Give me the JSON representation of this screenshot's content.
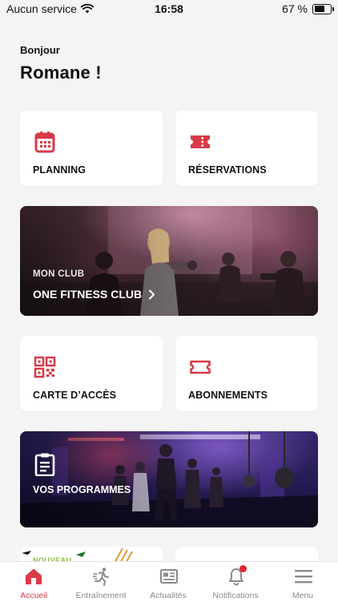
{
  "status_bar": {
    "carrier": "Aucun service",
    "time": "16:58",
    "battery_text": "67 %",
    "battery_level": 0.67
  },
  "header": {
    "greeting": "Bonjour",
    "user_name": "Romane !"
  },
  "tiles": {
    "planning": "PLANNING",
    "reservations": "RÉSERVATIONS",
    "access_card": "CARTE D’ACCÈS",
    "subscriptions": "ABONNEMENTS"
  },
  "club": {
    "subtitle": "MON CLUB",
    "name": "ONE FITNESS CLUB"
  },
  "programmes": {
    "label": "VOS PROGRAMMES"
  },
  "peek": {
    "badge": "NOUVEAU"
  },
  "tab_bar": {
    "items": [
      {
        "label": "Accueil",
        "icon": "home-icon",
        "active": true
      },
      {
        "label": "Entraînement",
        "icon": "running-icon",
        "active": false
      },
      {
        "label": "Actualités",
        "icon": "news-icon",
        "active": false
      },
      {
        "label": "Notifications",
        "icon": "bell-icon",
        "active": false
      },
      {
        "label": "Menu",
        "icon": "hamburger-icon",
        "active": false
      }
    ]
  },
  "colors": {
    "accent": "#d83a48",
    "background": "#f4f4f4",
    "card": "#ffffff",
    "notification_dot": "#e0252f"
  }
}
